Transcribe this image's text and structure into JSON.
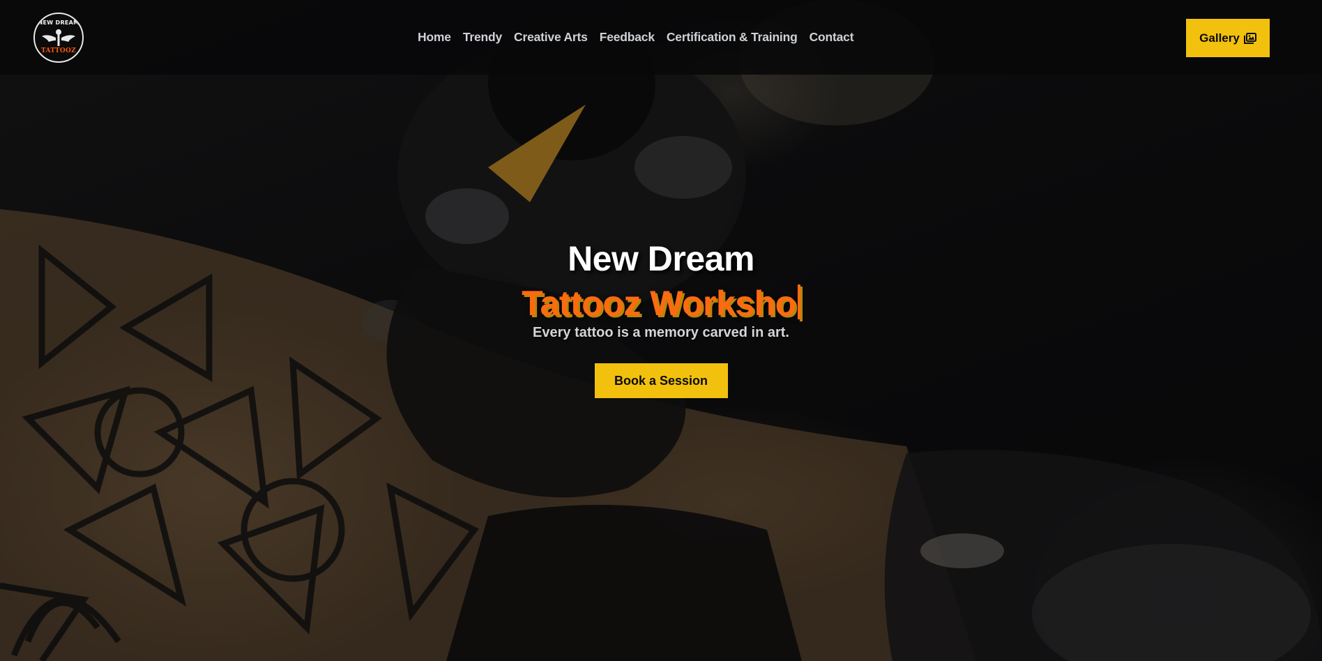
{
  "brand": {
    "logo_top_text": "NEW DREAM",
    "logo_bottom_text": "TATTOOZ"
  },
  "nav": {
    "items": [
      {
        "label": "Home"
      },
      {
        "label": "Trendy"
      },
      {
        "label": "Creative Arts"
      },
      {
        "label": "Feedback"
      },
      {
        "label": "Certification & Training"
      },
      {
        "label": "Contact"
      }
    ]
  },
  "header": {
    "gallery_label": "Gallery",
    "gallery_icon": "image-gallery-icon"
  },
  "hero": {
    "title_line1": "New Dream",
    "title_line2_typed": "Tattooz Worksho",
    "tagline": "Every tattoo is a memory carved in art.",
    "cta_label": "Book a Session"
  },
  "colors": {
    "accent_yellow": "#f2c10d",
    "accent_orange": "#ff6a10",
    "nav_text": "#cfd2d6",
    "navbar_bg": "#080809"
  }
}
